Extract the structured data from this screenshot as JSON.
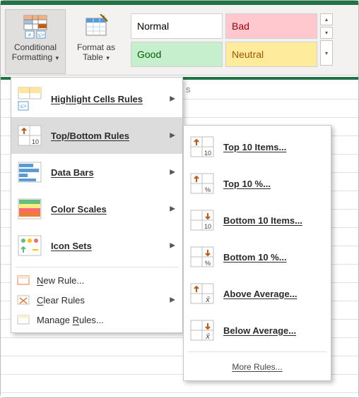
{
  "ribbon": {
    "conditional_formatting": "Conditional Formatting",
    "format_as_table": "Format as Table",
    "styles": {
      "normal": "Normal",
      "bad": "Bad",
      "good": "Good",
      "neutral": "Neutral"
    },
    "fragment": "s"
  },
  "menu": {
    "highlight": "Highlight Cells Rules",
    "topbottom": "Top/Bottom Rules",
    "databars": "Data Bars",
    "colorscales": "Color Scales",
    "iconsets": "Icon Sets",
    "newrule": "New Rule...",
    "clearrules": "Clear Rules",
    "managerules": "Manage Rules..."
  },
  "submenu": {
    "top10items": "Top 10 Items...",
    "top10pct": "Top 10 %...",
    "bottom10items": "Bottom 10 Items...",
    "bottom10pct": "Bottom 10 %...",
    "aboveavg": "Above Average...",
    "belowavg": "Below Average...",
    "more": "More Rules..."
  }
}
